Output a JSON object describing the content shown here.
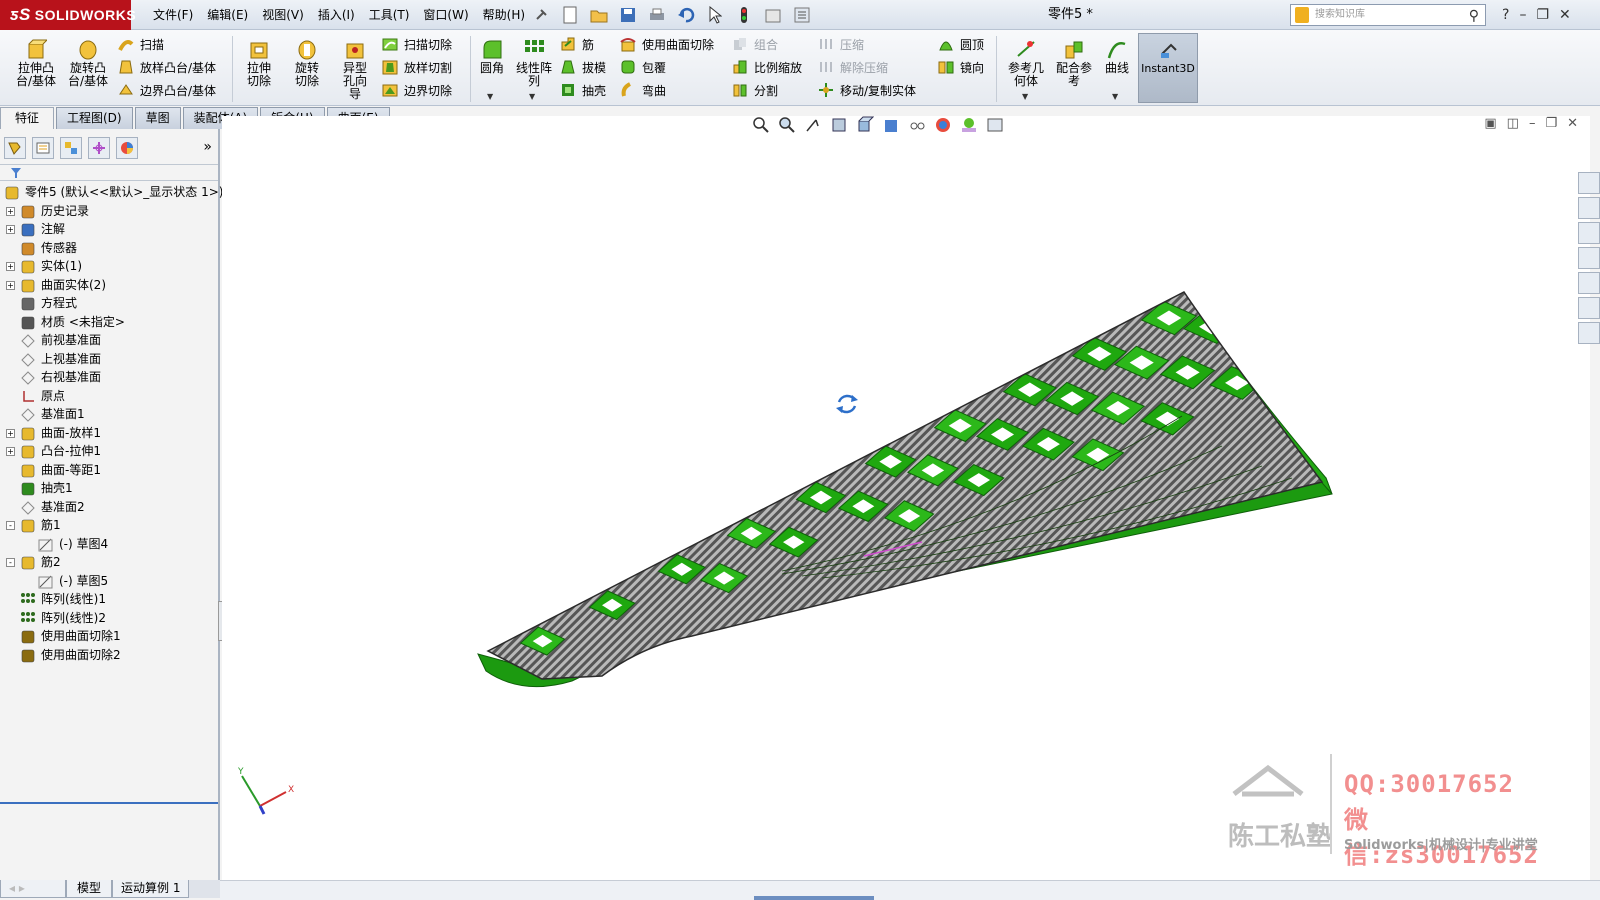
{
  "app": {
    "logo_text": "SOLIDWORKS",
    "brand_color": "#b8121b",
    "document_title": "零件5 *"
  },
  "menu": [
    "文件(F)",
    "编辑(E)",
    "视图(V)",
    "插入(I)",
    "工具(T)",
    "窗口(W)",
    "帮助(H)"
  ],
  "search": {
    "placeholder": "搜索知识库"
  },
  "toolbar": {
    "extrude_boss": "拉伸凸台/基体",
    "revolve_boss": "旋转凸台/基体",
    "sweep": "扫描",
    "loft_boss": "放样凸台/基体",
    "boundary_boss": "边界凸台/基体",
    "extrude_cut": "拉伸切除",
    "revolve_cut": "旋转切除",
    "hole_wizard": "异型孔向导",
    "sweep_cut": "扫描切除",
    "loft_cut": "放样切割",
    "boundary_cut": "边界切除",
    "fillet": "圆角",
    "linear_pattern": "线性阵列",
    "rib": "筋",
    "draft": "拔模",
    "shell": "抽壳",
    "surface_cut": "使用曲面切除",
    "wrap": "包覆",
    "flex": "弯曲",
    "combine": "组合",
    "scale": "比例缩放",
    "split": "分割",
    "indent": "压缩",
    "unsuppress": "解除压缩",
    "move_copy": "移动/复制实体",
    "dome": "圆顶",
    "mirror": "镜向",
    "ref_geometry": "参考几何体",
    "mate_ref": "配合参考",
    "curves": "曲线",
    "instant3d": "Instant3D"
  },
  "tabs": [
    "特征",
    "工程图(D)",
    "草图",
    "装配体(A)",
    "钣金(H)",
    "曲面(E)"
  ],
  "tree": [
    {
      "label": "零件5  (默认<<默认>_显示状态 1>)",
      "indent": 0,
      "expander": "",
      "icon": "part-icon"
    },
    {
      "label": "历史记录",
      "indent": 1,
      "expander": "+",
      "icon": "history-icon"
    },
    {
      "label": "注解",
      "indent": 1,
      "expander": "+",
      "icon": "annotation-icon"
    },
    {
      "label": "传感器",
      "indent": 1,
      "expander": "",
      "icon": "sensor-icon"
    },
    {
      "label": "实体(1)",
      "indent": 1,
      "expander": "+",
      "icon": "solid-body-icon"
    },
    {
      "label": "曲面实体(2)",
      "indent": 1,
      "expander": "+",
      "icon": "surface-body-icon"
    },
    {
      "label": "方程式",
      "indent": 1,
      "expander": "",
      "icon": "equation-icon"
    },
    {
      "label": "材质 <未指定>",
      "indent": 1,
      "expander": "",
      "icon": "material-icon"
    },
    {
      "label": "前视基准面",
      "indent": 1,
      "expander": "",
      "icon": "plane-icon"
    },
    {
      "label": "上视基准面",
      "indent": 1,
      "expander": "",
      "icon": "plane-icon"
    },
    {
      "label": "右视基准面",
      "indent": 1,
      "expander": "",
      "icon": "plane-icon"
    },
    {
      "label": "原点",
      "indent": 1,
      "expander": "",
      "icon": "origin-icon"
    },
    {
      "label": "基准面1",
      "indent": 1,
      "expander": "",
      "icon": "plane-icon"
    },
    {
      "label": "曲面-放样1",
      "indent": 1,
      "expander": "+",
      "icon": "surface-loft-icon"
    },
    {
      "label": "凸台-拉伸1",
      "indent": 1,
      "expander": "+",
      "icon": "boss-extrude-icon"
    },
    {
      "label": "曲面-等距1",
      "indent": 1,
      "expander": "",
      "icon": "surface-offset-icon"
    },
    {
      "label": "抽壳1",
      "indent": 1,
      "expander": "",
      "icon": "shell-icon"
    },
    {
      "label": "基准面2",
      "indent": 1,
      "expander": "",
      "icon": "plane-icon"
    },
    {
      "label": "筋1",
      "indent": 1,
      "expander": "-",
      "icon": "rib-icon"
    },
    {
      "label": "(-) 草图4",
      "indent": 2,
      "expander": "",
      "icon": "sketch-icon"
    },
    {
      "label": "筋2",
      "indent": 1,
      "expander": "-",
      "icon": "rib-icon"
    },
    {
      "label": "(-) 草图5",
      "indent": 2,
      "expander": "",
      "icon": "sketch-icon"
    },
    {
      "label": "阵列(线性)1",
      "indent": 1,
      "expander": "",
      "icon": "linear-pattern-icon"
    },
    {
      "label": "阵列(线性)2",
      "indent": 1,
      "expander": "",
      "icon": "linear-pattern-icon"
    },
    {
      "label": "使用曲面切除1",
      "indent": 1,
      "expander": "",
      "icon": "surface-cut-icon"
    },
    {
      "label": "使用曲面切除2",
      "indent": 1,
      "expander": "",
      "icon": "surface-cut-icon"
    }
  ],
  "bottom_tabs": [
    "模型",
    "运动算例 1"
  ],
  "watermark": {
    "qq": "QQ:30017652",
    "wechat": "微信:zs30017652",
    "name": "陈工私塾",
    "subtitle": "Solidworks|机械设计|专业讲堂"
  },
  "colors": {
    "model_green": "#22b014",
    "model_edge": "#0f5f0a",
    "hatch_gray": "#8f8f8f",
    "accent_blue": "#3a6fbf"
  }
}
